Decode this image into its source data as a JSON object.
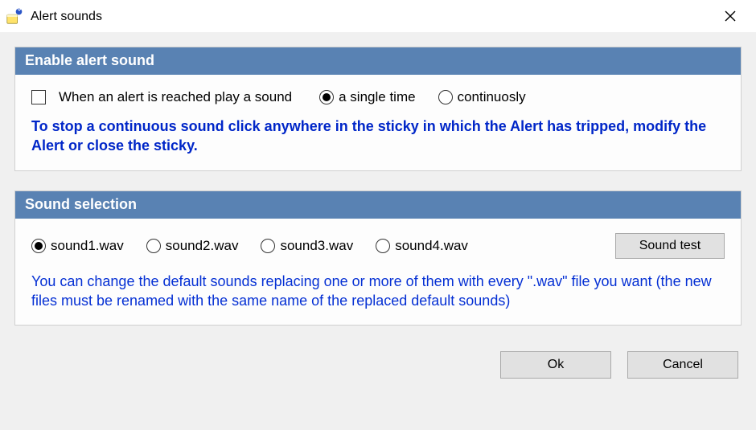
{
  "window": {
    "title": "Alert sounds"
  },
  "enable": {
    "header": "Enable alert sound",
    "checkbox_label": "When an alert is reached play a sound",
    "checkbox_checked": false,
    "play_mode": {
      "options": [
        {
          "label": "a single time",
          "checked": true
        },
        {
          "label": "continuosly",
          "checked": false
        }
      ]
    },
    "note": "To stop a continuous sound click anywhere in the sticky in which the Alert has tripped, modify the Alert or close the sticky."
  },
  "selection": {
    "header": "Sound selection",
    "sounds": [
      {
        "label": "sound1.wav",
        "checked": true
      },
      {
        "label": "sound2.wav",
        "checked": false
      },
      {
        "label": "sound3.wav",
        "checked": false
      },
      {
        "label": "sound4.wav",
        "checked": false
      }
    ],
    "test_button": "Sound test",
    "note": "You can change the default sounds replacing one or more of them with every  \".wav\" file you want  (the new files must be renamed with the same name of the replaced default sounds)"
  },
  "footer": {
    "ok": "Ok",
    "cancel": "Cancel"
  }
}
